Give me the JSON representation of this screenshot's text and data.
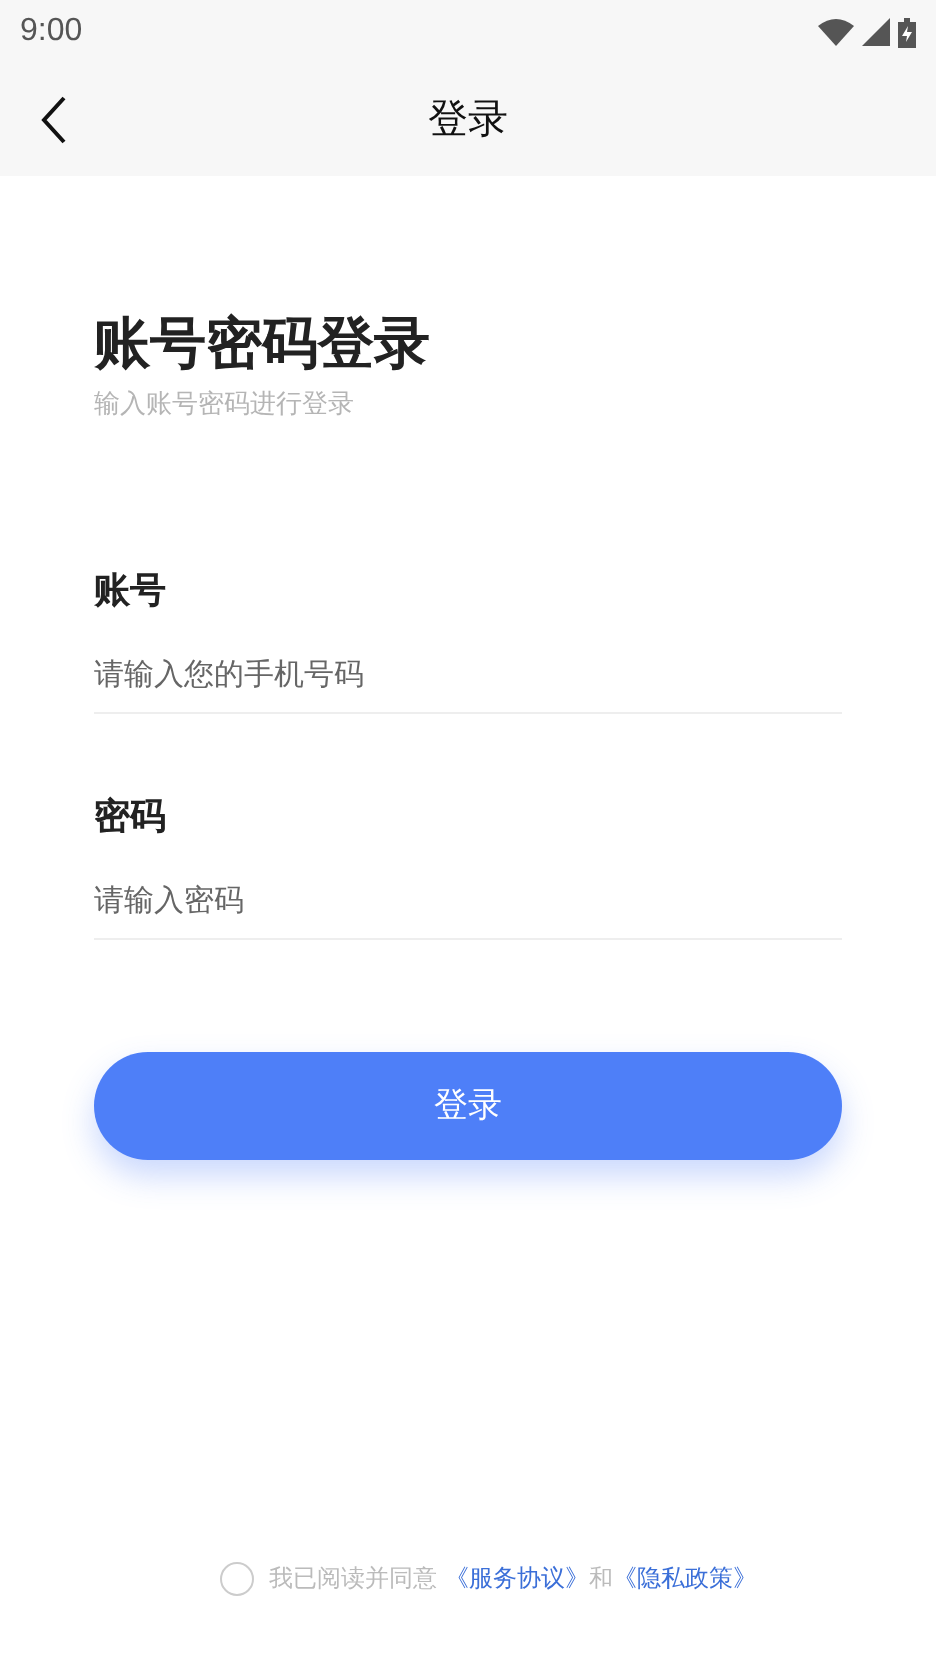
{
  "status_bar": {
    "time": "9:00"
  },
  "header": {
    "title": "登录"
  },
  "heading": {
    "title": "账号密码登录",
    "subtitle": "输入账号密码进行登录"
  },
  "fields": [
    {
      "label": "账号",
      "placeholder": "请输入您的手机号码"
    },
    {
      "label": "密码",
      "placeholder": "请输入密码"
    }
  ],
  "submit": "登录",
  "agreement": {
    "checked": false,
    "text": "我已阅读并同意",
    "link_1": "《服务协议》",
    "joiner": "和",
    "link_2": "《隐私政策》"
  }
}
